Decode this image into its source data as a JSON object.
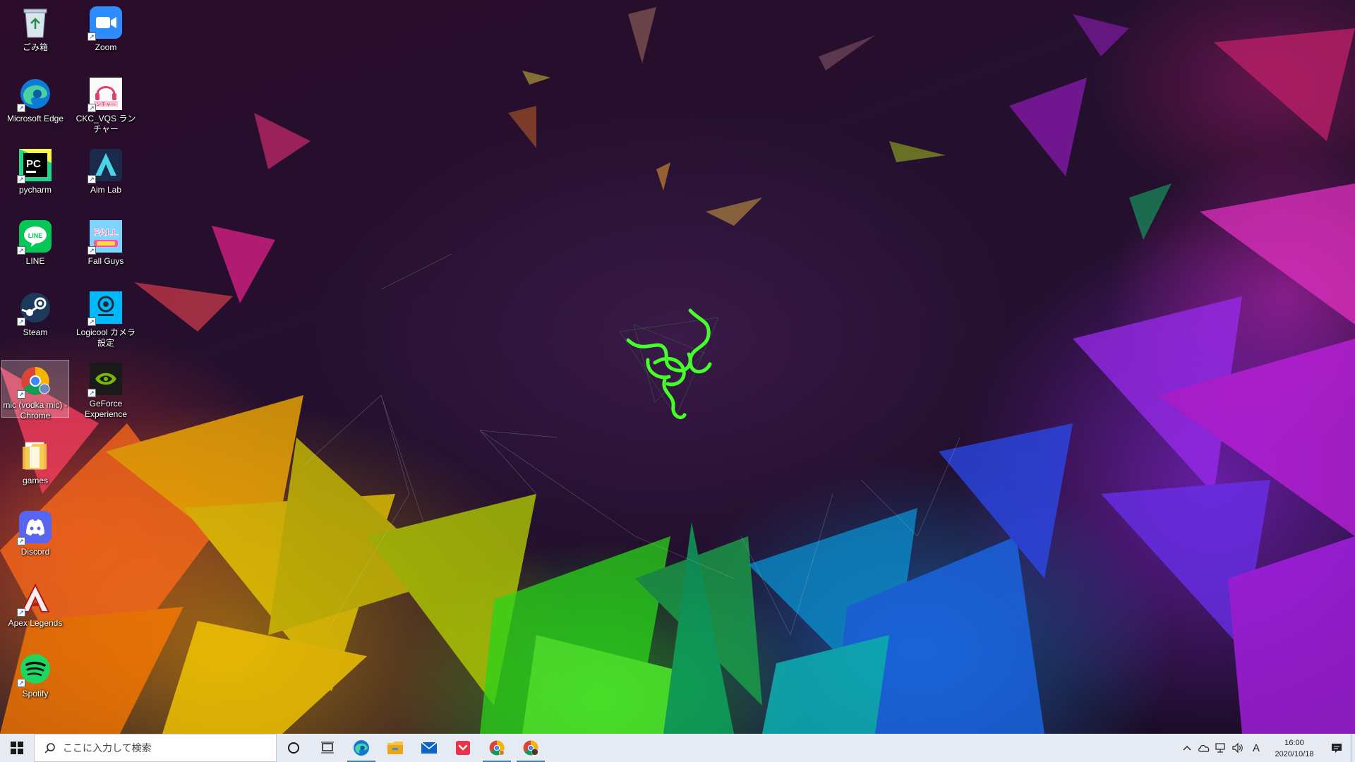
{
  "desktop": {
    "icons": [
      {
        "label": "ごみ箱",
        "icon": "recycle-bin-icon"
      },
      {
        "label": "Zoom",
        "icon": "zoom-icon"
      },
      {
        "label": "Microsoft Edge",
        "icon": "edge-icon"
      },
      {
        "label": "CKC_VQS ランチャー",
        "icon": "ckc-launcher-icon",
        "icon_text": "ンチャー"
      },
      {
        "label": "pycharm",
        "icon": "pycharm-icon",
        "icon_text": "PC"
      },
      {
        "label": "Aim Lab",
        "icon": "aim-lab-icon"
      },
      {
        "label": "LINE",
        "icon": "line-icon",
        "icon_text": "LINE"
      },
      {
        "label": "Fall Guys",
        "icon": "fall-guys-icon",
        "icon_text": "FALL"
      },
      {
        "label": "Steam",
        "icon": "steam-icon"
      },
      {
        "label": "Logicool カメラ設定",
        "icon": "logicool-camera-icon"
      },
      {
        "label": "mic (vodka mic) - Chrome",
        "icon": "chrome-app-icon"
      },
      {
        "label": "GeForce Experience",
        "icon": "geforce-icon"
      },
      {
        "label": "games",
        "icon": "folder-icon"
      },
      {
        "label": "Discord",
        "icon": "discord-icon"
      },
      {
        "label": "Apex Legends",
        "icon": "apex-icon"
      },
      {
        "label": "Spotify",
        "icon": "spotify-icon"
      }
    ]
  },
  "taskbar": {
    "search_placeholder": "ここに入力して検索",
    "pinned": [
      {
        "name": "edge",
        "icon": "edge-icon",
        "active": true
      },
      {
        "name": "file-explorer",
        "icon": "folder-icon",
        "active": false
      },
      {
        "name": "mail",
        "icon": "mail-icon",
        "active": false
      },
      {
        "name": "pocket",
        "icon": "pocket-icon",
        "active": false
      },
      {
        "name": "chrome",
        "icon": "chrome-icon",
        "active": true
      },
      {
        "name": "chrome-profile",
        "icon": "chrome-profile-icon",
        "active": true
      }
    ],
    "tray": {
      "ime": "A",
      "time": "16:00",
      "date": "2020/10/18"
    }
  },
  "colors": {
    "taskbar_bg": "#e6eaf2",
    "razer_green": "#44ff2a",
    "active_indicator": "#3a7bd5"
  }
}
